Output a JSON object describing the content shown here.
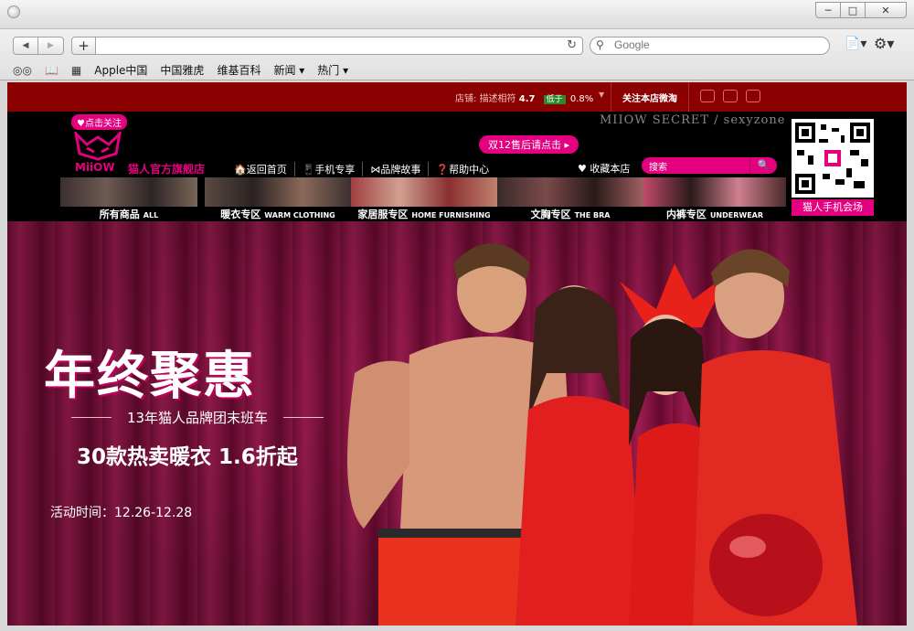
{
  "window": {
    "minimize": "─",
    "maximize": "□",
    "close": "✕"
  },
  "toolbar": {
    "back_icon": "◀",
    "forward_icon": "▶",
    "add_icon": "+",
    "reload_icon": "↻",
    "search_placeholder": "Google",
    "search_icon": "⚲",
    "page_icon": "📄▾",
    "settings_icon": "⚙▾"
  },
  "bookmarks": {
    "reader_icon": "◎◎",
    "book_icon": "📖",
    "grid_icon": "▦",
    "items": [
      "Apple中国",
      "中国雅虎",
      "维基百科",
      "新闻 ▾",
      "热门 ▾"
    ]
  },
  "store": {
    "rating_label": "店铺:",
    "rating_desc": "描述相符",
    "rating_score": "4.7",
    "rating_low": "低于",
    "rating_pct": "0.8%",
    "follow_weibo": "关注本店微淘",
    "follow_btn": "♥点击关注",
    "logo_word": "MiiOW",
    "store_name": "猫人官方旗舰店",
    "promo": "双12售后请点击 ▸",
    "brand_line": "MIIOW SECRET / sexyzone",
    "nav": [
      "🏠返回首页",
      "📱手机专享",
      "⋈品牌故事",
      "❓帮助中心"
    ],
    "favorite": "♥ 收藏本店",
    "search_placeholder": "搜索",
    "search_btn": "🔍",
    "qr_label": "猫人手机会场",
    "categories": [
      {
        "cn": "所有商品",
        "en": "ALL"
      },
      {
        "cn": "暖衣专区",
        "en": "WARM CLOTHING"
      },
      {
        "cn": "家居服专区",
        "en": "HOME FURNISHING"
      },
      {
        "cn": "文胸专区",
        "en": "THE BRA"
      },
      {
        "cn": "内裤专区",
        "en": "UNDERWEAR"
      }
    ]
  },
  "hero": {
    "headline": "年终聚惠",
    "subhead": "13年猫人品牌团末班车",
    "offer": "30款热卖暖衣 1.6折起",
    "time": "活动时间：12.26-12.28"
  }
}
